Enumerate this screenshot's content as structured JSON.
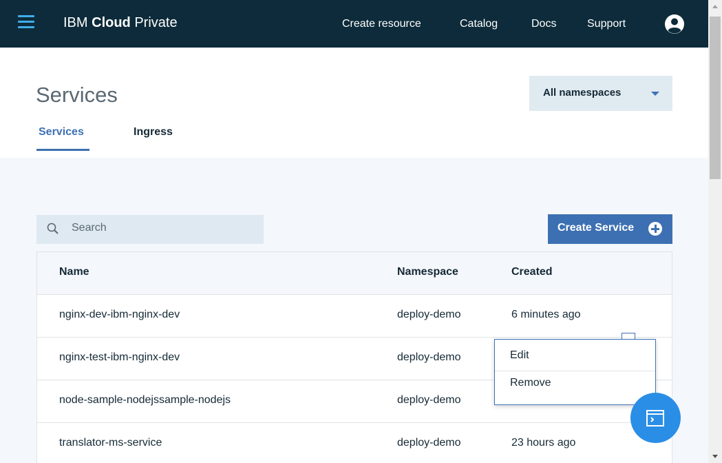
{
  "header": {
    "brand_prefix": "IBM ",
    "brand_bold": "Cloud",
    "brand_suffix": " Private",
    "nav": [
      "Create resource",
      "Catalog",
      "Docs",
      "Support"
    ]
  },
  "page": {
    "title": "Services",
    "namespace_select": "All namespaces",
    "tabs": [
      "Services",
      "Ingress"
    ],
    "active_tab": "Services"
  },
  "toolbar": {
    "search_placeholder": "Search",
    "create_button": "Create Service"
  },
  "table": {
    "columns": [
      "Name",
      "Namespace",
      "Created"
    ],
    "rows": [
      {
        "name": "nginx-dev-ibm-nginx-dev",
        "namespace": "deploy-demo",
        "created": "6 minutes ago"
      },
      {
        "name": "nginx-test-ibm-nginx-dev",
        "namespace": "deploy-demo",
        "created": ""
      },
      {
        "name": "node-sample-nodejssample-nodejs",
        "namespace": "deploy-demo",
        "created": ""
      },
      {
        "name": "translator-ms-service",
        "namespace": "deploy-demo",
        "created": "23 hours ago"
      }
    ]
  },
  "overflow_menu": {
    "items": [
      "Edit",
      "Remove"
    ]
  },
  "icons": {
    "menu": "hamburger-menu-icon",
    "user": "user-avatar-icon",
    "search": "search-icon",
    "add": "plus-circle-icon",
    "terminal": "terminal-icon"
  },
  "colors": {
    "topbar": "#0d2b3a",
    "accent": "#3d70b2",
    "fab": "#2a8ee6",
    "content_bg": "#f4f7fb"
  }
}
